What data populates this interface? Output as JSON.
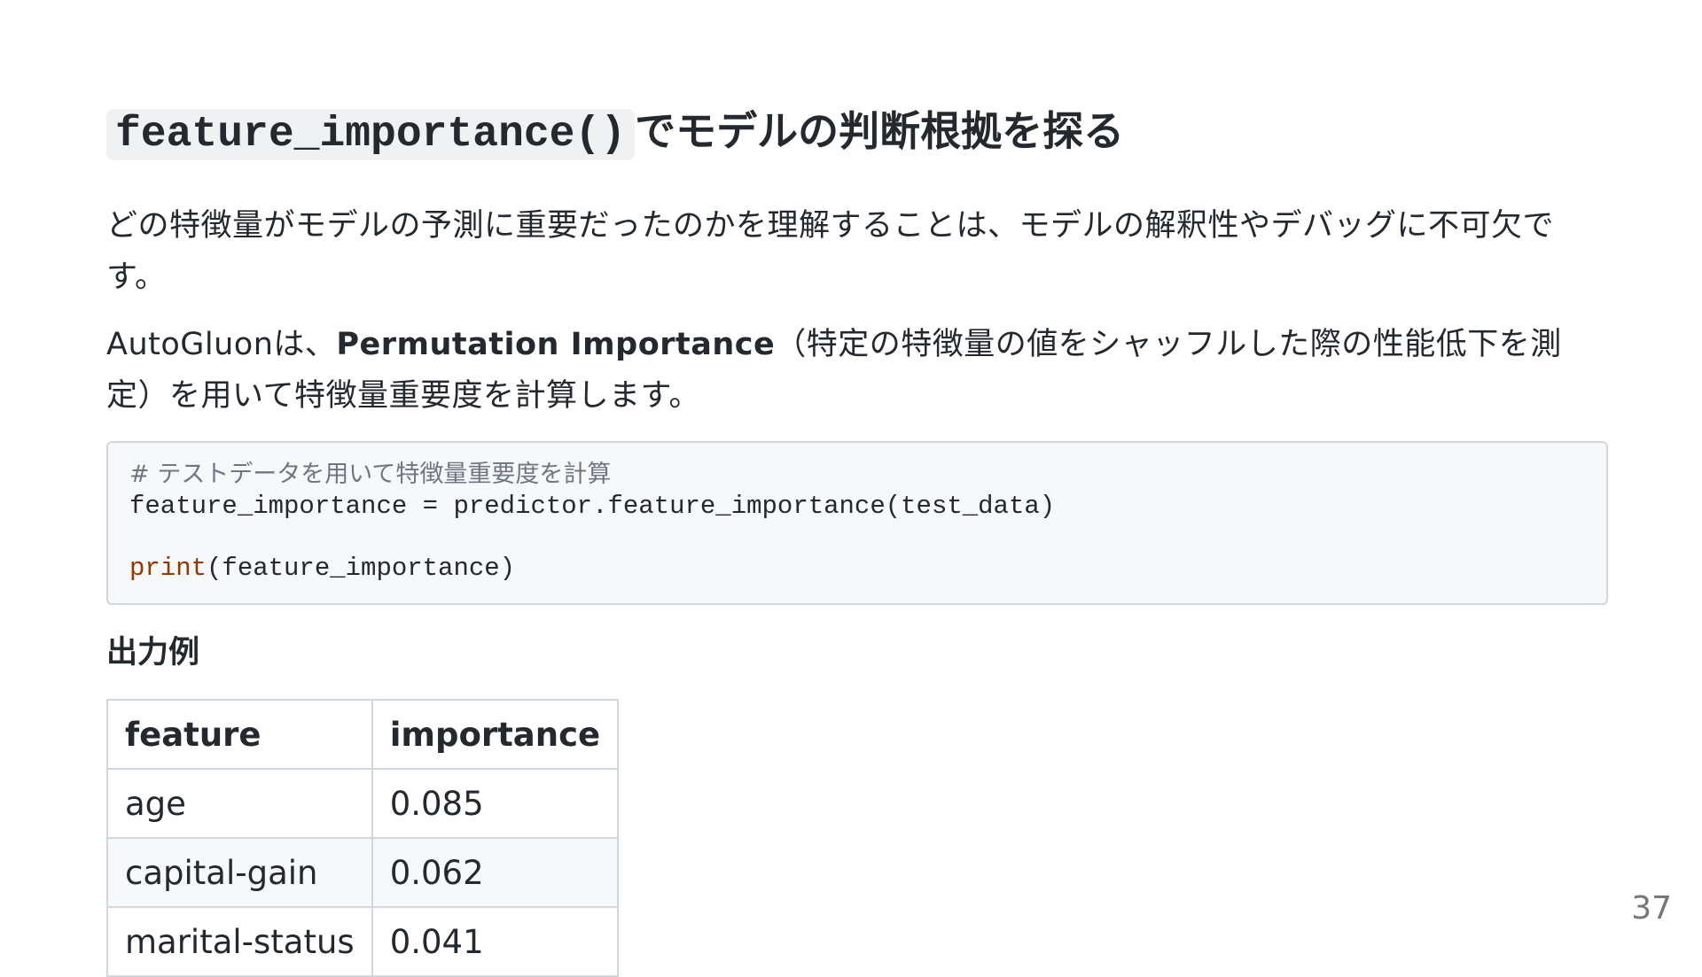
{
  "title": {
    "code": "feature_importance()",
    "text": "でモデルの判断根拠を探る"
  },
  "paragraph1": "どの特徴量がモデルの予測に重要だったのかを理解することは、モデルの解釈性やデバッグに不可欠です。",
  "paragraph2": {
    "before": "AutoGluonは、",
    "bold": "Permutation Importance",
    "after": "（特定の特徴量の値をシャッフルした際の性能低下を測定）を用いて特徴量重要度を計算します。"
  },
  "code": {
    "comment": "# テストデータを用いて特徴量重要度を計算",
    "line1": "feature_importance = predictor.feature_importance(test_data)",
    "print_kw": "print",
    "print_args": "(feature_importance)"
  },
  "output_heading": "出力例",
  "table": {
    "headers": [
      "feature",
      "importance"
    ],
    "rows": [
      [
        "age",
        "0.085"
      ],
      [
        "capital-gain",
        "0.062"
      ],
      [
        "marital-status",
        "0.041"
      ]
    ]
  },
  "page_number": "37"
}
